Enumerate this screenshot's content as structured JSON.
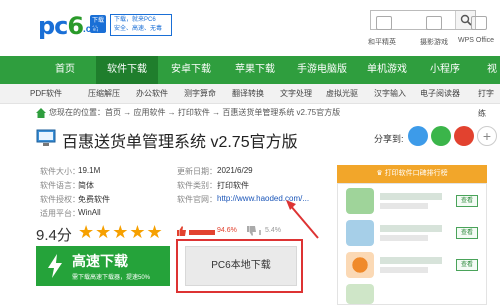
{
  "header": {
    "logo_main": "pc6",
    "logo_suffix": ".com",
    "logo_badge": "下载站",
    "slogan_line1": "下载，就来PC6",
    "slogan_line2": "安全、高速、无毒",
    "quick_links": [
      "和平精英",
      "摄影游戏",
      "WPS Office"
    ]
  },
  "nav": {
    "items": [
      "首页",
      "软件下载",
      "安卓下载",
      "苹果下载",
      "手游电脑版",
      "单机游戏",
      "小程序",
      "视"
    ],
    "active": "软件下载"
  },
  "subnav": {
    "items": [
      "PDF软件",
      "压缩解压",
      "办公软件",
      "测字算命",
      "翻译转换",
      "文字处理",
      "虚拟光驱",
      "汉字输入",
      "电子阅读器",
      "打字练"
    ]
  },
  "breadcrumb": {
    "text": "您现在的位置：首页 → 应用软件 → 打印软件 → 百惠送货单管理系统 v2.75官方版"
  },
  "app": {
    "title": "百惠送货单管理系统 v2.75官方版",
    "share_label": "分享到:"
  },
  "info": {
    "size_key": "软件大小：",
    "size_val": "19.1M",
    "date_key": "更新日期：",
    "date_val": "2021/6/29",
    "lang_key": "软件语言：",
    "lang_val": "简体",
    "cat_key": "软件类别：",
    "cat_val": "打印软件",
    "license_key": "软件授权：",
    "license_val": "免费软件",
    "site_key": "软件官网：",
    "site_val": "http://www.haoded.com/...",
    "platform_key": "适用平台：",
    "platform_val": "WinAll"
  },
  "rating": {
    "score": "9.4分",
    "stars": "★★★★★",
    "good_pct": "94.6%",
    "good_fraction": 0.946,
    "bad_pct": "5.4%",
    "bad_fraction": 0.054
  },
  "download": {
    "main_label": "高速下载",
    "main_sub": "需下载高速下载器，提速50%",
    "alt_label": "PC6本地下载"
  },
  "rank": {
    "head": "打印软件口碑排行榜",
    "view_label": "查看"
  },
  "colors": {
    "nav_green": "#2f9e3e",
    "download_green": "#25a33a",
    "rank_orange": "#f2a62a",
    "annotation_red": "#dd3333"
  }
}
